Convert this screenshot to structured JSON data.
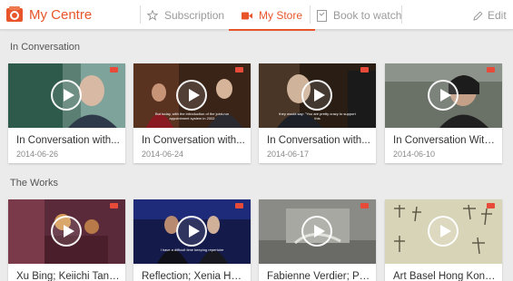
{
  "header": {
    "title": "My Centre",
    "nav": [
      {
        "label": "Subscription",
        "icon": "star-icon"
      },
      {
        "label": "My Store",
        "icon": "video-camera-icon",
        "active": true
      },
      {
        "label": "Book to watch",
        "icon": "bookmark-icon"
      }
    ],
    "edit_label": "Edit",
    "accent_color": "#e8552a"
  },
  "sections": [
    {
      "title": "In Conversation",
      "items": [
        {
          "title": "In Conversation with...",
          "date": "2014-06-26",
          "caption": ""
        },
        {
          "title": "In Conversation with...",
          "date": "2014-06-24",
          "caption": "But today, with the introduction of the joint-run appointment system in 2002"
        },
        {
          "title": "In Conversation with...",
          "date": "2014-06-17",
          "caption": "they would say: \"You are pretty crazy to support this"
        },
        {
          "title": "In Conversation With...",
          "date": "2014-06-10",
          "caption": ""
        }
      ]
    },
    {
      "title": "The Works",
      "items": [
        {
          "title": "Xu Bing; Keiichi Tana...",
          "caption": ""
        },
        {
          "title": "Reflection; Xenia Hau...",
          "caption": "I have a difficult time keeping repertoire"
        },
        {
          "title": "Fabienne Verdier; Proj...",
          "caption": ""
        },
        {
          "title": "Art Basel Hong Kong...",
          "caption": ""
        }
      ]
    }
  ]
}
